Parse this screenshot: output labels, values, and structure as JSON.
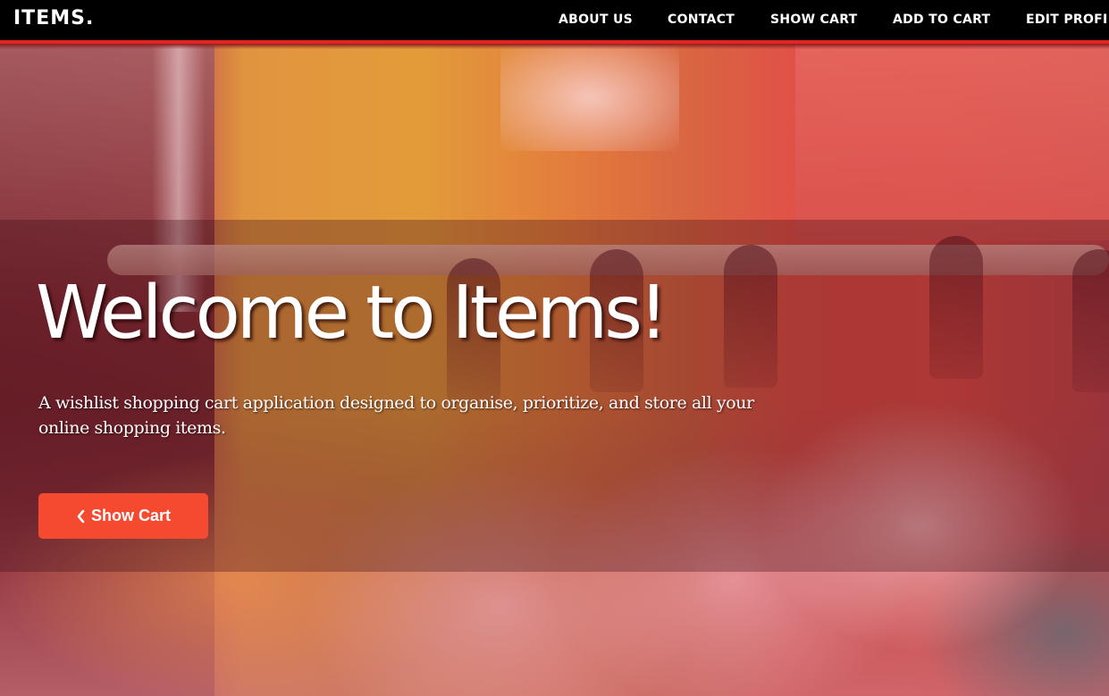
{
  "brand": {
    "name": "ITEMS."
  },
  "nav": {
    "items": [
      {
        "label": "ABOUT US"
      },
      {
        "label": "CONTACT"
      },
      {
        "label": "SHOW CART"
      },
      {
        "label": "ADD TO CART"
      },
      {
        "label": "EDIT PROFI"
      }
    ]
  },
  "hero": {
    "title": "Welcome to Items!",
    "subtitle": "A wishlist shopping cart application designed to organise, prioritize, and store all your online shopping items.",
    "button": {
      "label": "Show Cart",
      "icon": "chevron-left-icon"
    }
  },
  "colors": {
    "navbar_bg": "#000000",
    "navbar_accent": "#e3261d",
    "button_bg": "#f54a2f",
    "text": "#ffffff"
  }
}
